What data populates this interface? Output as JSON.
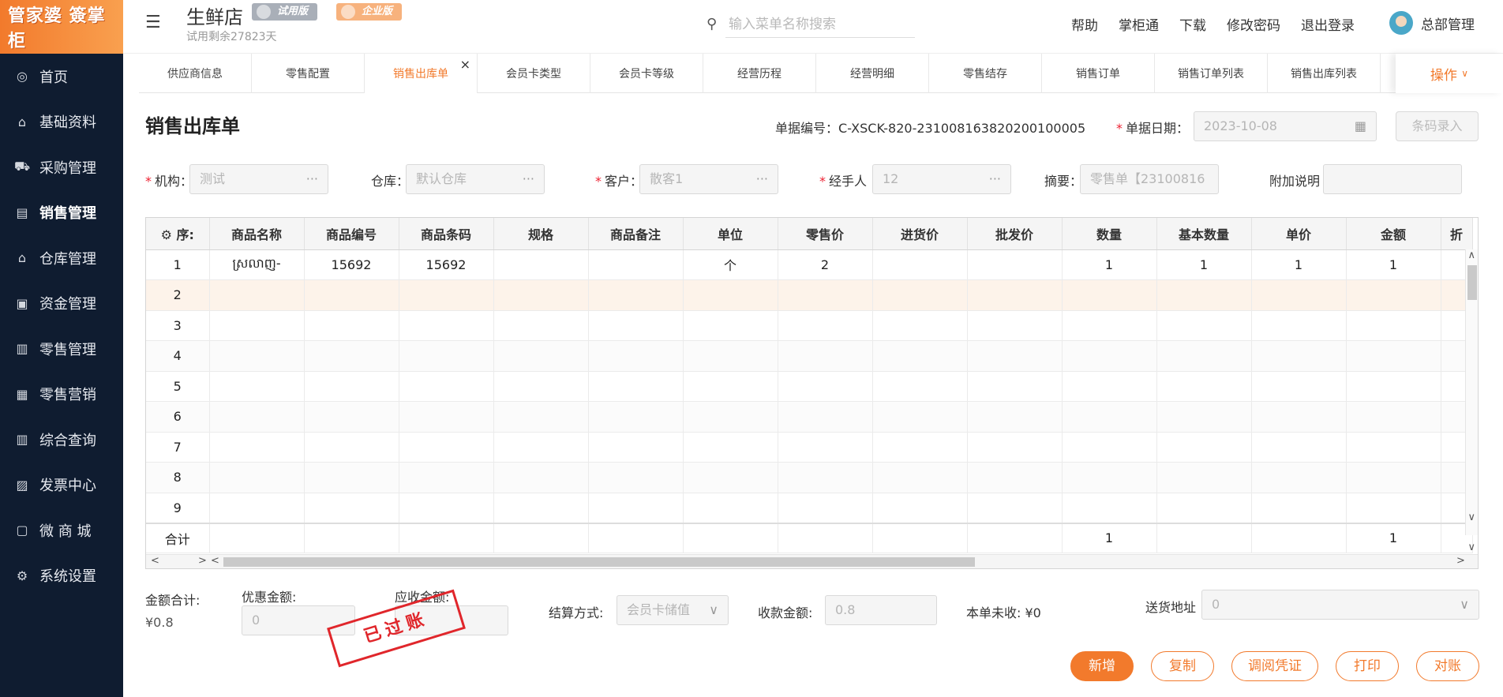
{
  "sidebar": {
    "logo": "管家婆 簽掌柜",
    "items": [
      {
        "label": "首页",
        "icon": "globe-icon",
        "glyph": "◎"
      },
      {
        "label": "基础资料",
        "icon": "home-icon",
        "glyph": "⌂"
      },
      {
        "label": "采购管理",
        "icon": "cart-icon",
        "glyph": "⛟"
      },
      {
        "label": "销售管理",
        "icon": "calendar-icon",
        "glyph": "▤"
      },
      {
        "label": "仓库管理",
        "icon": "bank-icon",
        "glyph": "⌂"
      },
      {
        "label": "资金管理",
        "icon": "wallet-icon",
        "glyph": "▣"
      },
      {
        "label": "零售管理",
        "icon": "chart-icon",
        "glyph": "▥"
      },
      {
        "label": "零售营销",
        "icon": "gift-icon",
        "glyph": "▦"
      },
      {
        "label": "综合查询",
        "icon": "bar-chart-icon",
        "glyph": "▥"
      },
      {
        "label": "发票中心",
        "icon": "invoice-icon",
        "glyph": "▨"
      },
      {
        "label": "微 商 城",
        "icon": "shop-bag-icon",
        "glyph": "▢"
      },
      {
        "label": "系统设置",
        "icon": "gear-icon",
        "glyph": "⚙"
      }
    ]
  },
  "header": {
    "store_name": "生鲜店",
    "trial_badge": "试用版",
    "enterprise_badge": "企业版",
    "trial_left": "试用剩余27823天",
    "search_placeholder": "输入菜单名称搜索",
    "links": [
      "帮助",
      "掌柜通",
      "下载",
      "修改密码",
      "退出登录"
    ],
    "user": "总部管理"
  },
  "tabs": [
    "供应商信息",
    "零售配置",
    "销售出库单",
    "会员卡类型",
    "会员卡等级",
    "经营历程",
    "经营明细",
    "零售结存",
    "销售订单",
    "销售订单列表",
    "销售出库列表"
  ],
  "ops_label": "操作",
  "form": {
    "title": "销售出库单",
    "doc_no_label": "单据编号：",
    "doc_no": "C-XSCK-820-231008163820200100005",
    "date_label": "单据日期：",
    "date": "2023-10-08",
    "barcode_btn": "条码录入",
    "org_label": "机构：",
    "org": "测试",
    "warehouse_label": "仓库：",
    "warehouse": "默认仓库",
    "customer_label": "客户：",
    "customer": "散客1",
    "handler_label": "经手人",
    "handler": "12",
    "summary_label": "摘要：",
    "summary": "零售单【23100816",
    "extra_label": "附加说明"
  },
  "grid": {
    "columns": [
      "序:",
      "商品名称",
      "商品编号",
      "商品条码",
      "规格",
      "商品备注",
      "单位",
      "零售价",
      "进货价",
      "批发价",
      "数量",
      "基本数量",
      "单价",
      "金额",
      "折"
    ],
    "rows": [
      [
        "1",
        "ស្រលាញ-",
        "15692",
        "15692",
        "",
        "",
        "个",
        "2",
        "",
        "",
        "1",
        "1",
        "1",
        "1",
        ""
      ],
      [
        "2",
        "",
        "",
        "",
        "",
        "",
        "",
        "",
        "",
        "",
        "",
        "",
        "",
        "",
        ""
      ],
      [
        "3",
        "",
        "",
        "",
        "",
        "",
        "",
        "",
        "",
        "",
        "",
        "",
        "",
        "",
        ""
      ],
      [
        "4",
        "",
        "",
        "",
        "",
        "",
        "",
        "",
        "",
        "",
        "",
        "",
        "",
        "",
        ""
      ],
      [
        "5",
        "",
        "",
        "",
        "",
        "",
        "",
        "",
        "",
        "",
        "",
        "",
        "",
        "",
        ""
      ],
      [
        "6",
        "",
        "",
        "",
        "",
        "",
        "",
        "",
        "",
        "",
        "",
        "",
        "",
        "",
        ""
      ],
      [
        "7",
        "",
        "",
        "",
        "",
        "",
        "",
        "",
        "",
        "",
        "",
        "",
        "",
        "",
        ""
      ],
      [
        "8",
        "",
        "",
        "",
        "",
        "",
        "",
        "",
        "",
        "",
        "",
        "",
        "",
        "",
        ""
      ],
      [
        "9",
        "",
        "",
        "",
        "",
        "",
        "",
        "",
        "",
        "",
        "",
        "",
        "",
        "",
        ""
      ]
    ],
    "footer": [
      "合计",
      "",
      "",
      "",
      "",
      "",
      "",
      "",
      "",
      "",
      "1",
      "",
      "",
      "1",
      ""
    ]
  },
  "summary": {
    "total_label": "金额合计:",
    "total": "¥0.8",
    "discount_label": "优惠金额:",
    "discount": "0",
    "receivable_label": "应收金额:",
    "stamp": "已过账",
    "settle_label": "结算方式:",
    "settle": "会员卡储值",
    "received_label": "收款金额:",
    "received": "0.8",
    "unpaid_label": "本单未收:",
    "unpaid": "¥0",
    "address_label": "送货地址",
    "address": "0"
  },
  "actions": [
    "新增",
    "复制",
    "调阅凭证",
    "打印",
    "对账"
  ]
}
